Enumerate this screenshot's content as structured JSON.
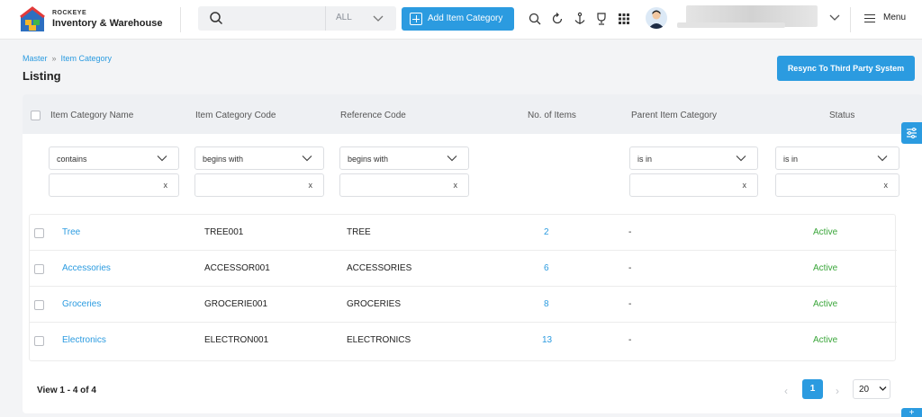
{
  "brand": {
    "small": "ROCKEYE",
    "name": "Inventory & Warehouse"
  },
  "search": {
    "placeholder": "",
    "scope": "ALL"
  },
  "header": {
    "add_button": "Add Item Category",
    "menu_label": "Menu"
  },
  "breadcrumb": {
    "items": [
      "Master",
      "Item Category"
    ],
    "separator": "»"
  },
  "page": {
    "title": "Listing",
    "resync_button": "Resync To Third Party System"
  },
  "table": {
    "columns": [
      "Item Category Name",
      "Item Category Code",
      "Reference Code",
      "No. of Items",
      "Parent Item Category",
      "Status"
    ],
    "filters": {
      "name_op": "contains",
      "code_op": "begins with",
      "ref_op": "begins with",
      "parent_op": "is in",
      "status_op": "is in",
      "clear": "x"
    },
    "rows": [
      {
        "name": "Tree",
        "code": "TREE001",
        "ref": "TREE",
        "items": "2",
        "parent": "-",
        "status": "Active"
      },
      {
        "name": "Accessories",
        "code": "ACCESSOR001",
        "ref": "ACCESSORIES",
        "items": "6",
        "parent": "-",
        "status": "Active"
      },
      {
        "name": "Groceries",
        "code": "GROCERIE001",
        "ref": "GROCERIES",
        "items": "8",
        "parent": "-",
        "status": "Active"
      },
      {
        "name": "Electronics",
        "code": "ELECTRON001",
        "ref": "ELECTRONICS",
        "items": "13",
        "parent": "-",
        "status": "Active"
      }
    ]
  },
  "pagination": {
    "view_text": "View 1 - 4 of 4",
    "prev": "‹",
    "current": "1",
    "next": "›",
    "page_size": "20"
  },
  "side": {
    "plus": "+"
  },
  "colors": {
    "accent": "#2b9be0",
    "active": "#3aa63a"
  }
}
